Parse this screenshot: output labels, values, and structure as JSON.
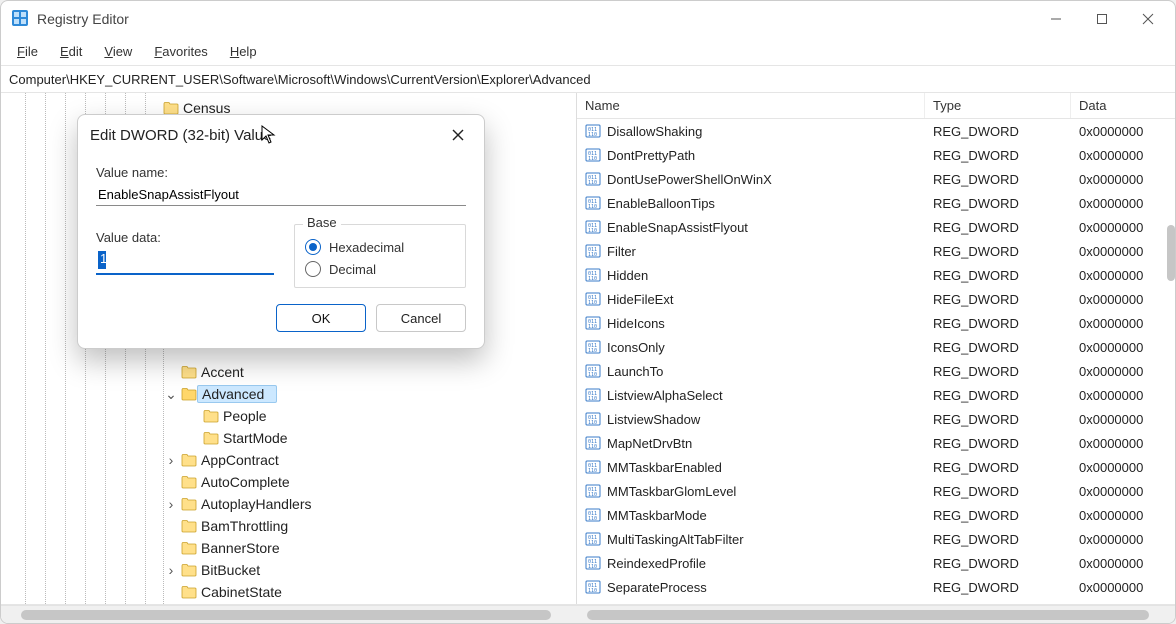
{
  "app": {
    "title": "Registry Editor"
  },
  "menu": {
    "file": "File",
    "edit": "Edit",
    "view": "View",
    "favorites": "Favorites",
    "help": "Help"
  },
  "address": "Computer\\HKEY_CURRENT_USER\\Software\\Microsoft\\Windows\\CurrentVersion\\Explorer\\Advanced",
  "tree": {
    "items": [
      {
        "indent": 144,
        "expander": "",
        "label": "Census"
      },
      {
        "indent": 162,
        "expander": "",
        "label": "Accent"
      },
      {
        "indent": 162,
        "expander": "v",
        "label": "Advanced",
        "selected": true
      },
      {
        "indent": 184,
        "expander": "",
        "label": "People"
      },
      {
        "indent": 184,
        "expander": "",
        "label": "StartMode"
      },
      {
        "indent": 162,
        "expander": ">",
        "label": "AppContract"
      },
      {
        "indent": 162,
        "expander": "",
        "label": "AutoComplete"
      },
      {
        "indent": 162,
        "expander": ">",
        "label": "AutoplayHandlers"
      },
      {
        "indent": 162,
        "expander": "",
        "label": "BamThrottling"
      },
      {
        "indent": 162,
        "expander": "",
        "label": "BannerStore"
      },
      {
        "indent": 162,
        "expander": ">",
        "label": "BitBucket"
      },
      {
        "indent": 162,
        "expander": "",
        "label": "CabinetState"
      }
    ]
  },
  "columns": {
    "name": "Name",
    "type": "Type",
    "data": "Data"
  },
  "rows": [
    {
      "name": "DisallowShaking",
      "type": "REG_DWORD",
      "data": "0x0000000"
    },
    {
      "name": "DontPrettyPath",
      "type": "REG_DWORD",
      "data": "0x0000000"
    },
    {
      "name": "DontUsePowerShellOnWinX",
      "type": "REG_DWORD",
      "data": "0x0000000"
    },
    {
      "name": "EnableBalloonTips",
      "type": "REG_DWORD",
      "data": "0x0000000"
    },
    {
      "name": "EnableSnapAssistFlyout",
      "type": "REG_DWORD",
      "data": "0x0000000"
    },
    {
      "name": "Filter",
      "type": "REG_DWORD",
      "data": "0x0000000"
    },
    {
      "name": "Hidden",
      "type": "REG_DWORD",
      "data": "0x0000000"
    },
    {
      "name": "HideFileExt",
      "type": "REG_DWORD",
      "data": "0x0000000"
    },
    {
      "name": "HideIcons",
      "type": "REG_DWORD",
      "data": "0x0000000"
    },
    {
      "name": "IconsOnly",
      "type": "REG_DWORD",
      "data": "0x0000000"
    },
    {
      "name": "LaunchTo",
      "type": "REG_DWORD",
      "data": "0x0000000"
    },
    {
      "name": "ListviewAlphaSelect",
      "type": "REG_DWORD",
      "data": "0x0000000"
    },
    {
      "name": "ListviewShadow",
      "type": "REG_DWORD",
      "data": "0x0000000"
    },
    {
      "name": "MapNetDrvBtn",
      "type": "REG_DWORD",
      "data": "0x0000000"
    },
    {
      "name": "MMTaskbarEnabled",
      "type": "REG_DWORD",
      "data": "0x0000000"
    },
    {
      "name": "MMTaskbarGlomLevel",
      "type": "REG_DWORD",
      "data": "0x0000000"
    },
    {
      "name": "MMTaskbarMode",
      "type": "REG_DWORD",
      "data": "0x0000000"
    },
    {
      "name": "MultiTaskingAltTabFilter",
      "type": "REG_DWORD",
      "data": "0x0000000"
    },
    {
      "name": "ReindexedProfile",
      "type": "REG_DWORD",
      "data": "0x0000000"
    },
    {
      "name": "SeparateProcess",
      "type": "REG_DWORD",
      "data": "0x0000000"
    }
  ],
  "dialog": {
    "title": "Edit DWORD (32-bit) Value",
    "value_name_label": "Value name:",
    "value_name": "EnableSnapAssistFlyout",
    "value_data_label": "Value data:",
    "value_data": "1",
    "base_label": "Base",
    "radio_hex": "Hexadecimal",
    "radio_dec": "Decimal",
    "ok": "OK",
    "cancel": "Cancel"
  }
}
